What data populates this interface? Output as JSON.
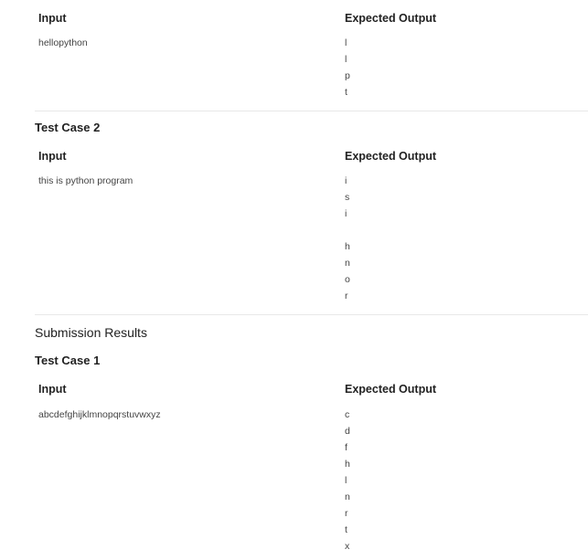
{
  "block1": {
    "input_header": "Input",
    "output_header": "Expected Output",
    "input_value": "hellopython",
    "output_lines": [
      "l",
      "l",
      "p",
      "t"
    ]
  },
  "block2": {
    "title": "Test Case 2",
    "input_header": "Input",
    "output_header": "Expected Output",
    "input_value": "this is python program",
    "output_lines": [
      "i",
      "s",
      "i",
      "",
      "h",
      "n",
      "o",
      "r"
    ]
  },
  "submission": {
    "title": "Submission Results",
    "test_case_title": "Test Case 1",
    "input_header": "Input",
    "output_header": "Expected Output",
    "input_value": "abcdefghijklmnopqrstuvwxyz",
    "output_lines": [
      "c",
      "d",
      "f",
      "h",
      "l",
      "n",
      "r",
      "t",
      "x"
    ]
  }
}
